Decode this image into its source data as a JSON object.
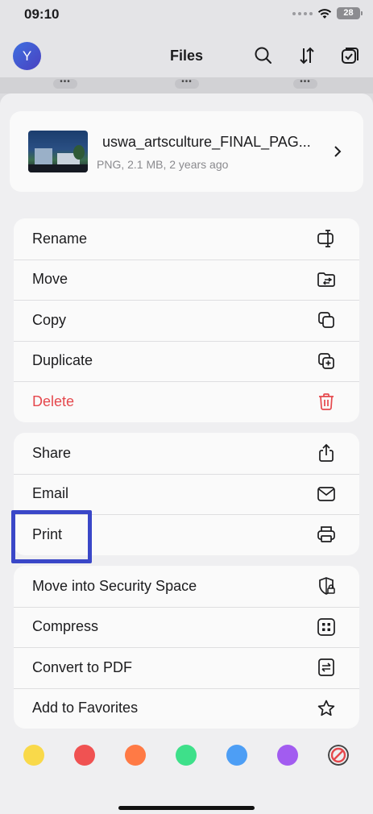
{
  "status_bar": {
    "time": "09:10",
    "battery": "28"
  },
  "header": {
    "avatar_initial": "Y",
    "title": "Files",
    "more_label": "•••"
  },
  "file": {
    "name": "uswa_artsculture_FINAL_PAG...",
    "meta": "PNG, 2.1 MB, 2 years ago"
  },
  "actions_group1": [
    {
      "label": "Rename",
      "icon": "rename-icon"
    },
    {
      "label": "Move",
      "icon": "move-folder-icon"
    },
    {
      "label": "Copy",
      "icon": "copy-icon"
    },
    {
      "label": "Duplicate",
      "icon": "duplicate-icon"
    },
    {
      "label": "Delete",
      "icon": "trash-icon",
      "color": "#e5484d"
    }
  ],
  "actions_group2": [
    {
      "label": "Share",
      "icon": "share-icon"
    },
    {
      "label": "Email",
      "icon": "mail-icon"
    },
    {
      "label": "Print",
      "icon": "printer-icon"
    }
  ],
  "actions_group3": [
    {
      "label": "Move into Security Space",
      "icon": "shield-lock-icon"
    },
    {
      "label": "Compress",
      "icon": "compress-icon"
    },
    {
      "label": "Convert to PDF",
      "icon": "convert-icon"
    },
    {
      "label": "Add to Favorites",
      "icon": "star-icon"
    }
  ],
  "tag_colors": [
    "#f9d94a",
    "#f05252",
    "#ff7a45",
    "#3ee08a",
    "#4d9ef5",
    "#a25cf0",
    "clear"
  ],
  "colors": {
    "accent": "#3a47c8",
    "danger": "#e5484d"
  }
}
